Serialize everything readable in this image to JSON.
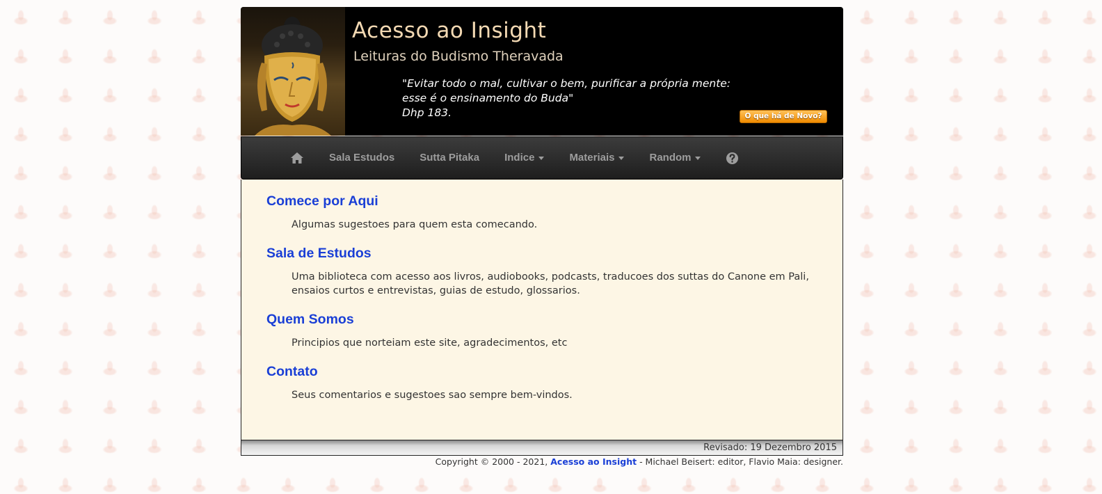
{
  "banner": {
    "title": "Acesso ao Insight",
    "subtitle": "Leituras do Budismo Theravada",
    "quote_line1": "\"Evitar todo o mal, cultivar o bem, purificar a própria mente:",
    "quote_line2": "esse é o ensinamento do Buda\"",
    "quote_line3": "Dhp 183.",
    "news_button": "O que há de Novo?"
  },
  "nav": {
    "home_icon": "home-icon",
    "items": [
      {
        "label": "Sala Estudos"
      },
      {
        "label": "Sutta Pitaka"
      },
      {
        "label": "Indice"
      },
      {
        "label": "Materiais"
      },
      {
        "label": "Random"
      }
    ],
    "help_icon": "question-circle-icon"
  },
  "sections": [
    {
      "title": "Comece por Aqui",
      "desc": "Algumas sugestoes para quem esta comecando."
    },
    {
      "title": "Sala de Estudos",
      "desc": "Uma biblioteca com acesso aos livros, audiobooks, podcasts, traducoes dos suttas do Canone em Pali, ensaios curtos e entrevistas, guias de estudo, glossarios."
    },
    {
      "title": "Quem Somos",
      "desc": "Principios que norteiam este site, agradecimentos, etc"
    },
    {
      "title": "Contato",
      "desc": "Seus comentarios e sugestoes sao sempre bem-vindos."
    }
  ],
  "footer": {
    "revised": "Revisado: 19 Dezembro 2015",
    "copyright_prefix": "Copyright © 2000 - 2021, ",
    "copyright_link": "Acesso ao Insight",
    "copyright_suffix": " - Michael Beisert: editor, Flavio Maia: designer."
  },
  "colors": {
    "link": "#1a3fd6",
    "content_bg": "#fdf6e5",
    "navbar": "#2a2a2a",
    "news_button": "#f59a10"
  }
}
